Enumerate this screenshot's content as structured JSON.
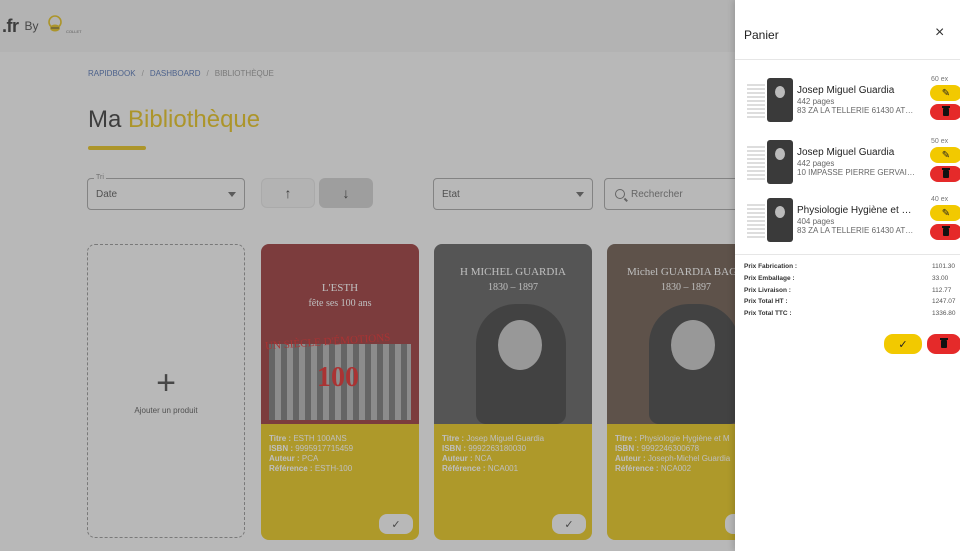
{
  "header": {
    "brand": ".fr",
    "by_label": "By",
    "logo_text": "COLLET"
  },
  "breadcrumb": {
    "root": "RAPIDBOOK",
    "sep": "/",
    "dashboard": "DASHBOARD",
    "current": "BIBLIOTHÈQUE"
  },
  "page": {
    "title_plain": "Ma",
    "title_accent": "Bibliothèque"
  },
  "filters": {
    "sort_label": "Tri",
    "sort_value": "Date",
    "state_value": "Etat",
    "search_placeholder": "Rechercher"
  },
  "add_card": {
    "plus": "+",
    "label": "Ajouter un produit"
  },
  "books": [
    {
      "cover_line1": "L'ESTH",
      "cover_line2": "fête ses 100 ans",
      "cover_banner": "UN SIÈCLE D'ÉMOTIONS",
      "cover_number": "100",
      "title_label": "Titre :",
      "title": "ESTH 100ANS",
      "isbn_label": "ISBN :",
      "isbn": "9995917715459",
      "author_label": "Auteur :",
      "author": "PCA",
      "ref_label": "Référence :",
      "ref": "ESTH-100"
    },
    {
      "cover_line1": "H MICHEL GUARDIA",
      "cover_line2": "1830 – 1897",
      "title_label": "Titre :",
      "title": "Josep Miguel Guardia",
      "isbn_label": "ISBN :",
      "isbn": "9992263180030",
      "author_label": "Auteur :",
      "author": "NCA",
      "ref_label": "Référence :",
      "ref": "NCA001"
    },
    {
      "cover_line1": "Michel GUARDIA BAGU",
      "cover_line2": "1830 – 1897",
      "title_label": "Titre :",
      "title": "Physiologie Hygiène et M",
      "isbn_label": "ISBN :",
      "isbn": "9992246300678",
      "author_label": "Auteur :",
      "author": "Joseph-Michel Guardia",
      "ref_label": "Référence :",
      "ref": "NCA002"
    }
  ],
  "cart": {
    "title": "Panier",
    "close": "×",
    "items": [
      {
        "name": "Josep Miguel Guardia",
        "pages": "442 pages",
        "address": "83 ZA LA TELLERIE 61430 ATH...",
        "qty": "60 ex"
      },
      {
        "name": "Josep Miguel Guardia",
        "pages": "442 pages",
        "address": "10 IMPASSE PIERRE GERVAIS ...",
        "qty": "50 ex"
      },
      {
        "name": "Physiologie Hygiène et Mo...",
        "pages": "404 pages",
        "address": "83 ZA LA TELLERIE 61430 ATH...",
        "qty": "40 ex"
      }
    ],
    "totals": [
      {
        "label": "Prix Fabrication :",
        "value": "1101.30"
      },
      {
        "label": "Prix Emballage :",
        "value": "33.00"
      },
      {
        "label": "Prix Livraison :",
        "value": "112.77"
      },
      {
        "label": "Prix Total HT :",
        "value": "1247.07"
      },
      {
        "label": "Prix Total TTC :",
        "value": "1336.80"
      }
    ]
  },
  "icons": {
    "check": "✓",
    "edit": "✎",
    "up": "↑",
    "down": "↓"
  }
}
